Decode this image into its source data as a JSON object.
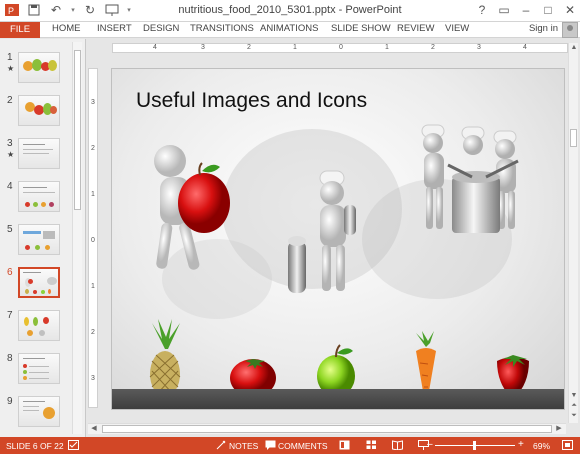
{
  "window": {
    "title": "nutritious_food_2010_5301.pptx - PowerPoint",
    "quick_access": [
      "powerpoint-logo",
      "save-icon",
      "undo-icon",
      "redo-icon",
      "slideshow-from-start-icon"
    ]
  },
  "ribbon": {
    "tabs": [
      "FILE",
      "HOME",
      "INSERT",
      "DESIGN",
      "TRANSITIONS",
      "ANIMATIONS",
      "SLIDE SHOW",
      "REVIEW",
      "VIEW"
    ],
    "sign_in": "Sign in"
  },
  "thumbnails": [
    {
      "num": "1",
      "star": "★"
    },
    {
      "num": "2",
      "star": ""
    },
    {
      "num": "3",
      "star": "★"
    },
    {
      "num": "4",
      "star": ""
    },
    {
      "num": "5",
      "star": ""
    },
    {
      "num": "6",
      "star": "",
      "active": true
    },
    {
      "num": "7",
      "star": ""
    },
    {
      "num": "8",
      "star": ""
    },
    {
      "num": "9",
      "star": ""
    }
  ],
  "ruler": {
    "h_labels": [
      "4",
      "3",
      "2",
      "1",
      "0",
      "1",
      "2",
      "3",
      "4"
    ],
    "v_labels": [
      "3",
      "2",
      "1",
      "0",
      "1",
      "2",
      "3"
    ]
  },
  "slide": {
    "title": "Useful Images and Icons"
  },
  "status": {
    "slide_info": "SLIDE 6 OF 22",
    "notes": "NOTES",
    "comments": "COMMENTS",
    "zoom": "69%"
  },
  "colors": {
    "accent": "#d24726",
    "status_bar": "#d24726"
  }
}
